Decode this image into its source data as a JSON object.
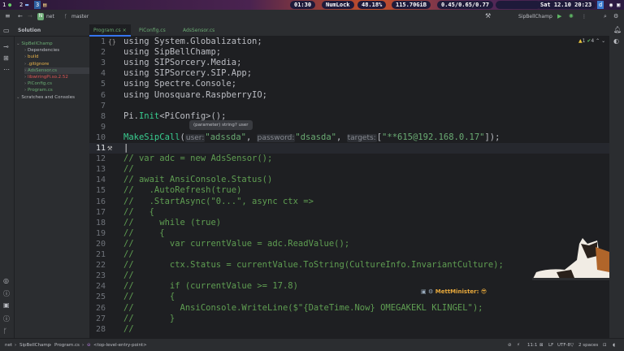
{
  "topbar": {
    "workspaces": [
      "1",
      "2",
      "3"
    ],
    "clock_short": "01:30",
    "numlock": "NumLock",
    "battery": "48.18%",
    "disk": "115.70GiB",
    "load": "0.45/0.65/0.77",
    "datetime": "Sat 12.10 20:23"
  },
  "toolbar": {
    "project": "net",
    "branch": "master",
    "run_config": "SipBellChamp"
  },
  "tabs": [
    {
      "label": "Program.cs",
      "active": true
    },
    {
      "label": "PiConfig.cs"
    },
    {
      "label": "AdsSensor.cs"
    }
  ],
  "project": {
    "header": "Solution",
    "items": [
      {
        "label": "SipBellChamp",
        "depth": 0,
        "color": "#6aab73"
      },
      {
        "label": "Dependencies",
        "depth": 1,
        "color": "#bcbec4"
      },
      {
        "label": "build",
        "depth": 1,
        "color": "#e8b24a"
      },
      {
        "label": ".gitignore",
        "depth": 1,
        "color": "#e8b24a"
      },
      {
        "label": "AdsSensor.cs",
        "depth": 1,
        "color": "#6aab73",
        "selected": true
      },
      {
        "label": "libwiringPi.so.2.52",
        "depth": 1,
        "color": "#e05555"
      },
      {
        "label": "PiConfig.cs",
        "depth": 1,
        "color": "#6aab73"
      },
      {
        "label": "Program.cs",
        "depth": 1,
        "color": "#6aab73"
      },
      {
        "label": "Scratches and Consoles",
        "depth": 0,
        "color": "#bcbec4"
      }
    ]
  },
  "editor": {
    "inspections": {
      "warnings": "1",
      "ok": "4"
    },
    "tooltip": "(parameter) string? user",
    "lines": [
      {
        "n": "1",
        "t": [
          [
            "k",
            "using System.Globalization;"
          ]
        ]
      },
      {
        "n": "2",
        "t": [
          [
            "k",
            "using SipBellChamp;"
          ]
        ]
      },
      {
        "n": "3",
        "t": [
          [
            "k",
            "using SIPSorcery.Media;"
          ]
        ]
      },
      {
        "n": "4",
        "t": [
          [
            "k",
            "using SIPSorcery.SIP.App;"
          ]
        ]
      },
      {
        "n": "5",
        "t": [
          [
            "k",
            "using Spectre.Console;"
          ]
        ]
      },
      {
        "n": "6",
        "t": [
          [
            "k",
            "using Unosquare.RaspberryIO;"
          ]
        ]
      },
      {
        "n": "7",
        "t": []
      },
      {
        "n": "8",
        "t": [
          [
            "k",
            "Pi."
          ],
          [
            "fn",
            "Init"
          ],
          [
            "k",
            "<PiConfig>();"
          ]
        ]
      },
      {
        "n": "9",
        "t": []
      },
      {
        "n": "10",
        "t": [
          [
            "fn",
            "MakeSipCall"
          ],
          [
            "k",
            "("
          ],
          [
            "h",
            "user:"
          ],
          [
            "s",
            "\"adssda\""
          ],
          [
            "k",
            ", "
          ],
          [
            "h",
            "password:"
          ],
          [
            "s",
            "\"dsasda\""
          ],
          [
            "k",
            ", "
          ],
          [
            "h",
            "targets:"
          ],
          [
            "k",
            "["
          ],
          [
            "s",
            "\"**615@192.168.0.17\""
          ],
          [
            "k",
            "]);"
          ]
        ]
      },
      {
        "n": "11",
        "t": [
          [
            "k",
            ""
          ]
        ],
        "current": true
      },
      {
        "n": "12",
        "t": [
          [
            "c",
            "// var adc = new AdsSensor();"
          ]
        ]
      },
      {
        "n": "13",
        "t": [
          [
            "c",
            "//"
          ]
        ]
      },
      {
        "n": "14",
        "t": [
          [
            "c",
            "// await AnsiConsole.Status()"
          ]
        ]
      },
      {
        "n": "15",
        "t": [
          [
            "c",
            "//   .AutoRefresh(true)"
          ]
        ]
      },
      {
        "n": "16",
        "t": [
          [
            "c",
            "//   .StartAsync(\"0...\", async ctx =>"
          ]
        ]
      },
      {
        "n": "17",
        "t": [
          [
            "c",
            "//   {"
          ]
        ]
      },
      {
        "n": "18",
        "t": [
          [
            "c",
            "//     while (true)"
          ]
        ]
      },
      {
        "n": "19",
        "t": [
          [
            "c",
            "//     {"
          ]
        ]
      },
      {
        "n": "20",
        "t": [
          [
            "c",
            "//       var currentValue = adc.ReadValue();"
          ]
        ]
      },
      {
        "n": "21",
        "t": [
          [
            "c",
            "//"
          ]
        ]
      },
      {
        "n": "22",
        "t": [
          [
            "c",
            "//       ctx.Status = currentValue.ToString(CultureInfo.InvariantCulture);"
          ]
        ]
      },
      {
        "n": "23",
        "t": [
          [
            "c",
            "//"
          ]
        ]
      },
      {
        "n": "24",
        "t": [
          [
            "c",
            "//       if (currentValue >= 17.8)"
          ]
        ]
      },
      {
        "n": "25",
        "t": [
          [
            "c",
            "//       {"
          ]
        ]
      },
      {
        "n": "26",
        "t": [
          [
            "c",
            "//         AnsiConsole.WriteLine($\"{DateTime.Now} OMEGAKEKL KLINGEL\");"
          ]
        ]
      },
      {
        "n": "27",
        "t": [
          [
            "c",
            "//       }"
          ]
        ]
      },
      {
        "n": "28",
        "t": [
          [
            "c",
            "//"
          ]
        ]
      }
    ]
  },
  "chat": {
    "username": "MettMinister:"
  },
  "status": {
    "breadcrumb": [
      "net",
      "SipBellChamp",
      "Program.cs",
      "<top-level-entry-point>"
    ],
    "position": "11:1",
    "line_ending": "LF",
    "encoding": "UTF-8",
    "indent": "2 spaces"
  }
}
